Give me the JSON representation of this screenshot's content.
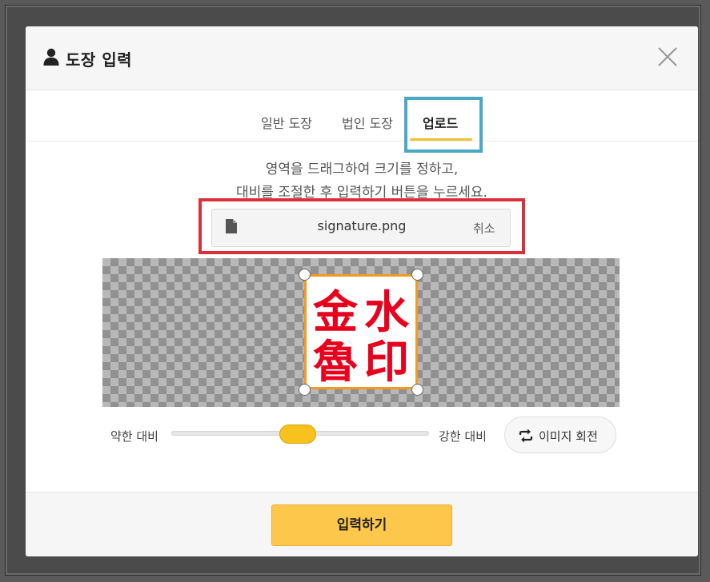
{
  "dialog": {
    "title": "도장 입력"
  },
  "tabs": [
    {
      "label": "일반 도장",
      "active": false
    },
    {
      "label": "법인 도장",
      "active": false
    },
    {
      "label": "업로드",
      "active": true
    }
  ],
  "instructions": {
    "line1": "영역을 드래그하여 크기를 정하고,",
    "line2": "대비를 조절한 후 입력하기 버튼을 누르세요."
  },
  "file": {
    "name": "signature.png",
    "cancel_label": "취소"
  },
  "stamp": {
    "characters": [
      "金",
      "水",
      "魯",
      "印"
    ],
    "color": "#e8001c"
  },
  "contrast": {
    "weak_label": "약한 대비",
    "strong_label": "강한 대비",
    "value": 0.49
  },
  "rotate_button_label": "이미지 회전",
  "submit_label": "입력하기",
  "colors": {
    "accent": "#fcc74a",
    "slider_thumb": "#f7c21e",
    "crop_border": "#f59a1e",
    "annotation_blue": "#4aa8c4",
    "annotation_red": "#d8313c"
  }
}
